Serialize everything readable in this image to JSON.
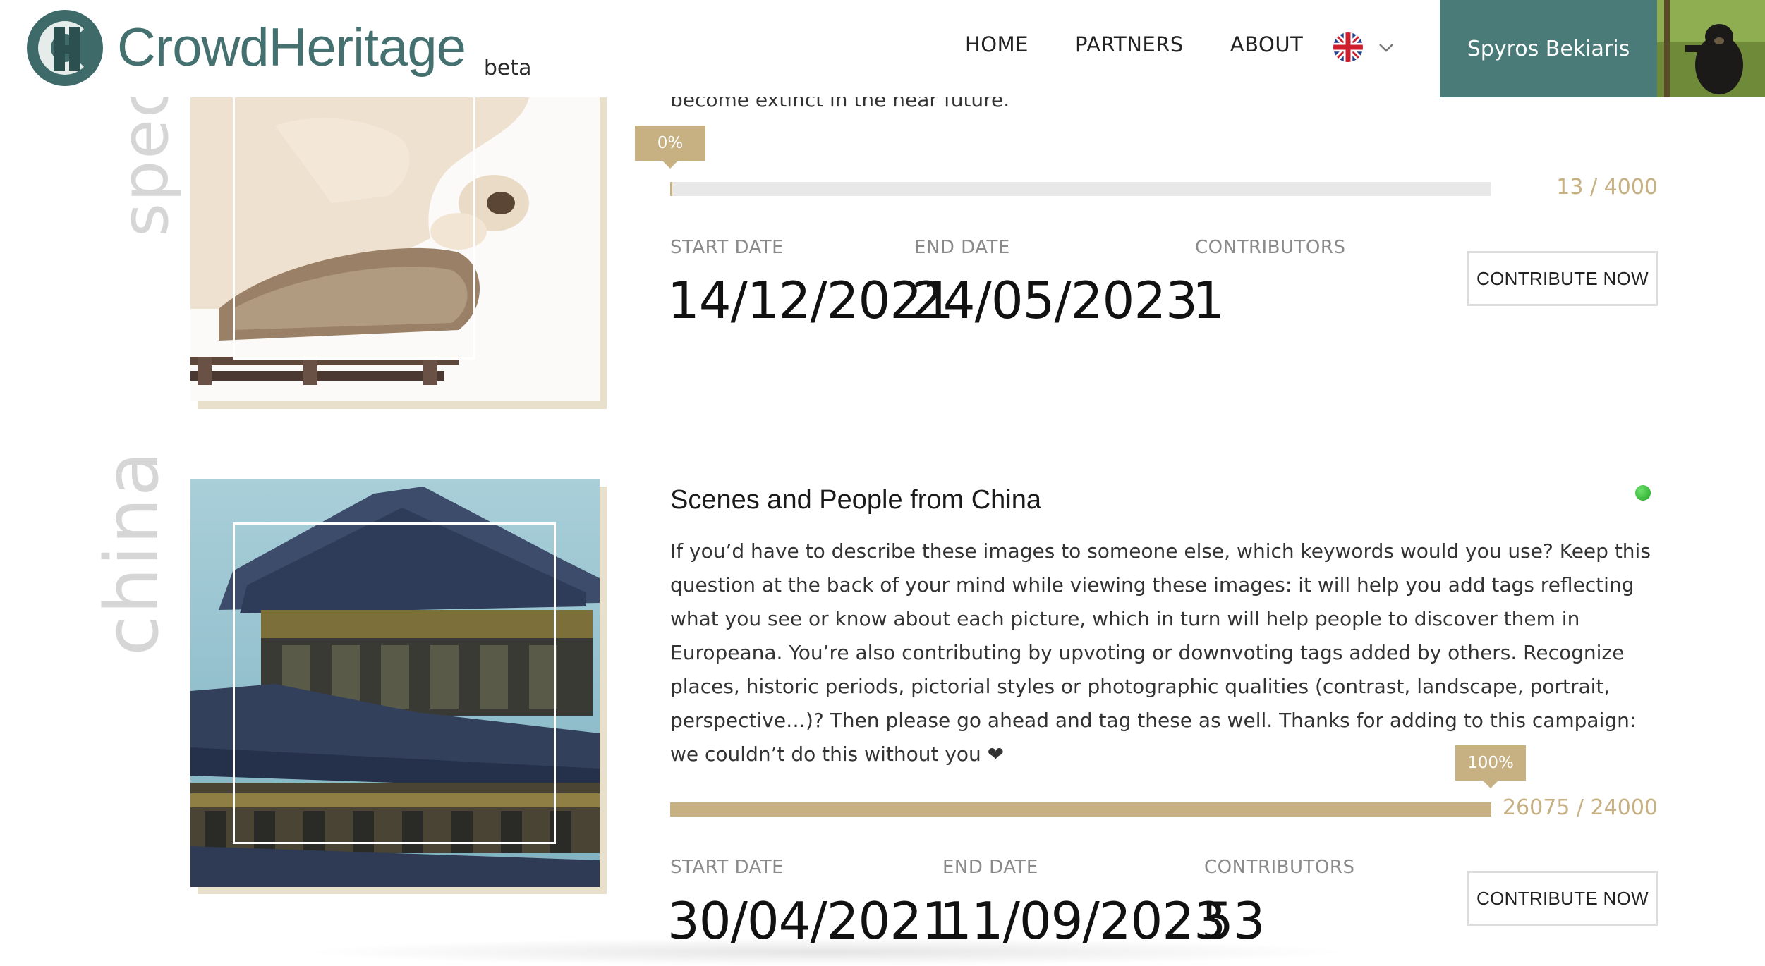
{
  "header": {
    "brand": "CrowdHeritage",
    "badge": "beta",
    "nav": [
      {
        "label": "HOME"
      },
      {
        "label": "PARTNERS"
      },
      {
        "label": "ABOUT"
      }
    ],
    "language_icon": "uk-flag-icon",
    "user_name": "Spyros Bekiaris"
  },
  "campaigns": [
    {
      "side_label": "spec",
      "description_tail": "become extinct in the near future.",
      "progress_percent_label": "0%",
      "progress_fraction": 0.003,
      "count": "13 / 4000",
      "start_label": "START DATE",
      "start_date": "14/12/2021",
      "end_label": "END DATE",
      "end_date": "24/05/2023",
      "contributors_label": "CONTRIBUTORS",
      "contributors": "1",
      "cta": "CONTRIBUTE NOW"
    },
    {
      "side_label": "china",
      "title": "Scenes and People from China",
      "status": "active",
      "status_color": "#2fb52f",
      "description": "If you’d have to describe these images to someone else, which keywords would you use? Keep this question at the back of your mind while viewing these images: it will help you add tags reflecting what you see or know about each picture, which in turn will help people to discover them in Europeana. You’re also contributing by upvoting or downvoting tags added by others. Recognize places, historic periods, pictorial styles or photographic qualities (contrast, landscape, portrait, perspective…)? Then please go ahead and tag these as well. Thanks for adding to this campaign: we couldn’t do this without you ❤",
      "progress_percent_label": "100%",
      "progress_fraction": 1.0,
      "count": "26075 / 24000",
      "start_label": "START DATE",
      "start_date": "30/04/2021",
      "end_label": "END DATE",
      "end_date": "11/09/2023",
      "contributors_label": "CONTRIBUTORS",
      "contributors": "53",
      "cta": "CONTRIBUTE NOW"
    }
  ],
  "colors": {
    "brand": "#44706f",
    "user_panel": "#4a7b79",
    "accent": "#c7b081"
  }
}
